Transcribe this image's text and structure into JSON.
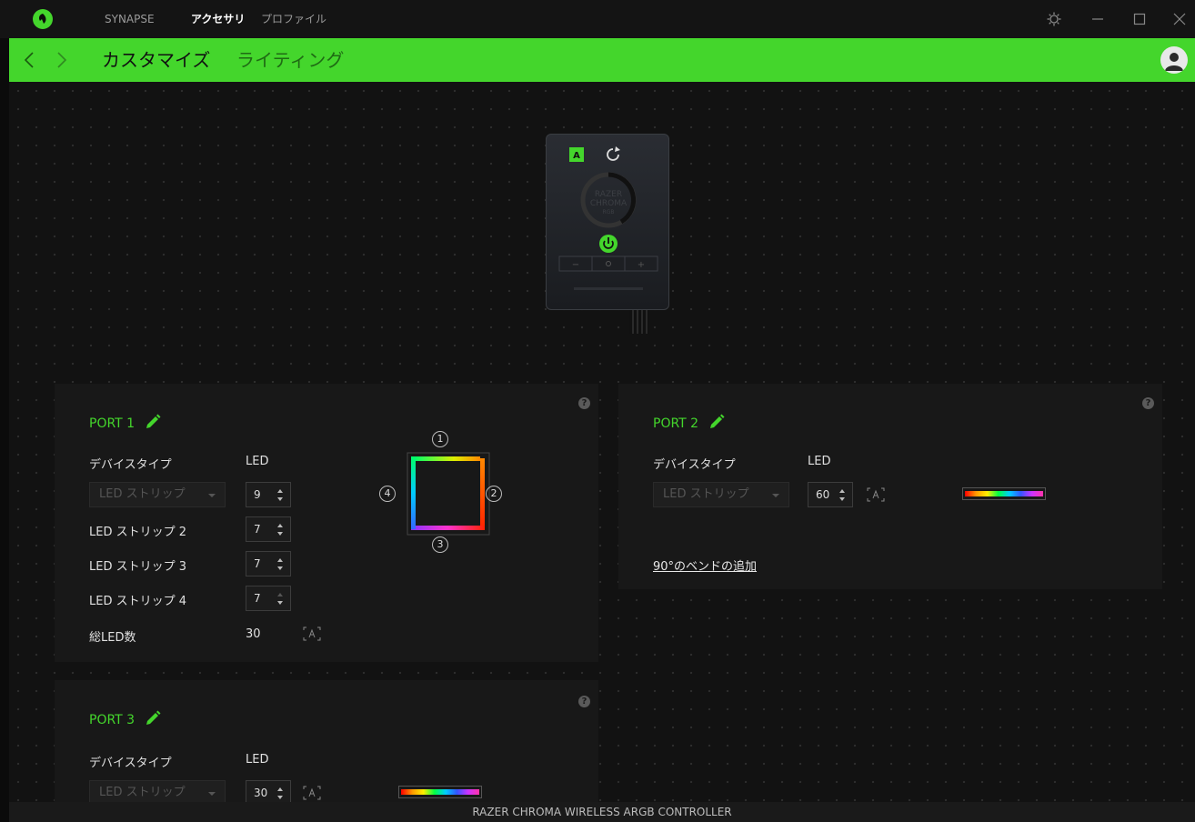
{
  "titlebar": {
    "tabs": [
      {
        "label": "SYNAPSE",
        "active": false
      },
      {
        "label": "アクセサリ",
        "active": true
      },
      {
        "label": "プロファイル",
        "active": false
      }
    ],
    "icons": [
      "razer-logo-icon",
      "settings-icon",
      "minimize-icon",
      "maximize-icon",
      "close-icon"
    ]
  },
  "subbar": {
    "tabs": [
      {
        "label": "カスタマイズ",
        "active": true
      },
      {
        "label": "ライティング",
        "active": false
      }
    ],
    "accent_color": "#44d62c"
  },
  "controller": {
    "brand_line1": "RAZER",
    "brand_line2": "CHROMA",
    "brand_line3": "RGB"
  },
  "ports": {
    "port1": {
      "title": "PORT 1",
      "device_type_label": "デバイスタイプ",
      "led_label": "LED",
      "device_type_value": "LED ストリップ",
      "first_led": "9",
      "strips": [
        {
          "label": "LED ストリップ 2",
          "value": "7"
        },
        {
          "label": "LED ストリップ 3",
          "value": "7"
        },
        {
          "label": "LED ストリップ 4",
          "value": "7"
        }
      ],
      "total_label": "総LED数",
      "total_value": "30",
      "diagram_numbers": [
        "1",
        "2",
        "3",
        "4"
      ]
    },
    "port2": {
      "title": "PORT 2",
      "device_type_label": "デバイスタイプ",
      "led_label": "LED",
      "device_type_value": "LED ストリップ",
      "led_value": "60",
      "add_bend_link": "90°のベンドの追加"
    },
    "port3": {
      "title": "PORT 3",
      "device_type_label": "デバイスタイプ",
      "led_label": "LED",
      "device_type_value": "LED ストリップ",
      "led_value": "30"
    }
  },
  "statusbar": {
    "device_name": "RAZER CHROMA WIRELESS ARGB CONTROLLER"
  }
}
